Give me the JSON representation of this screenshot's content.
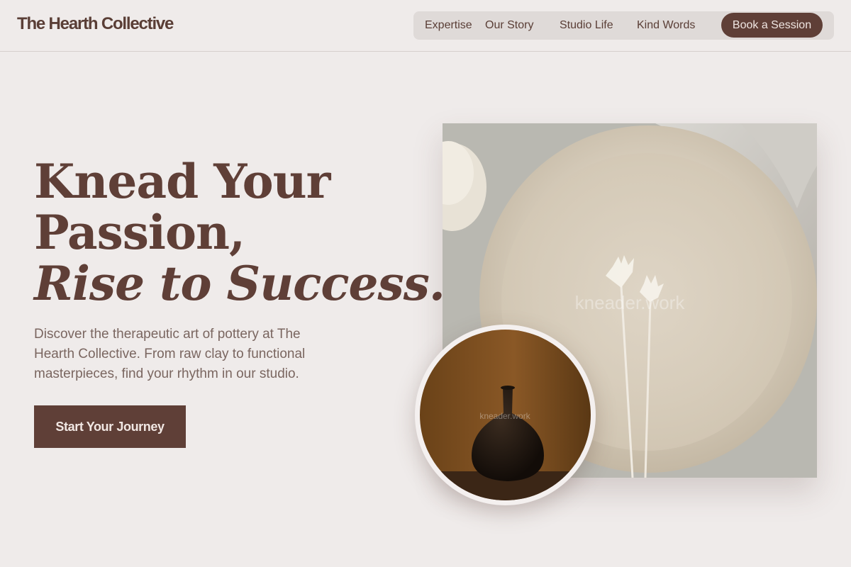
{
  "header": {
    "logo": "The Hearth Collective",
    "nav": [
      "Expertise",
      "Our Story",
      "Studio Life",
      "Kind Words"
    ],
    "cta": "Book a Session"
  },
  "hero": {
    "title_line1": "Knead Your",
    "title_line2": "Passion,",
    "title_line3": "Rise to Success.",
    "description": "Discover the therapeutic art of pottery at The Hearth Collective. From raw clay to functional masterpieces, find your rhythm in our studio.",
    "button": "Start Your Journey"
  },
  "images": {
    "plate_watermark": "kneader.work",
    "vase_watermark": "kneader.work"
  },
  "colors": {
    "background": "#efebea",
    "brand": "#5f3f37",
    "nav_bg": "#dfdad8"
  }
}
